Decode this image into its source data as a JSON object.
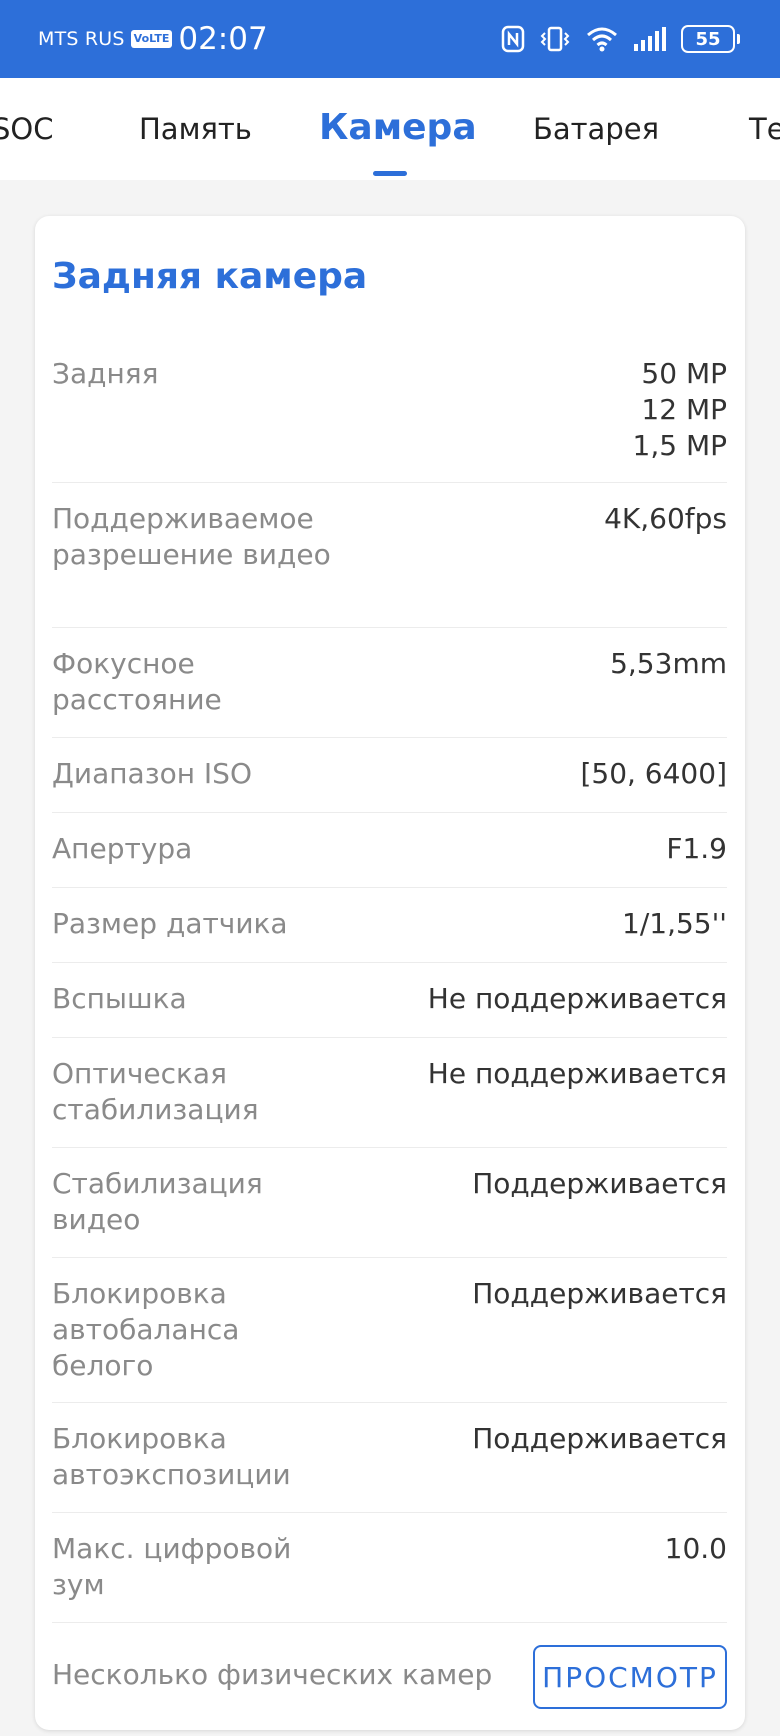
{
  "status_bar": {
    "carrier": "MTS RUS",
    "volte": "VoLTE",
    "time": "02:07",
    "battery_level": "55",
    "icons": [
      "nfc-icon",
      "vibrate-icon",
      "wifi-icon",
      "signal-icon",
      "battery-icon"
    ],
    "color": "#2d6fd9"
  },
  "tabs": [
    {
      "label": "SOC",
      "active": false
    },
    {
      "label": "Память",
      "active": false
    },
    {
      "label": "Камера",
      "active": true
    },
    {
      "label": "Батарея",
      "active": false
    },
    {
      "label": "Те",
      "active": false
    }
  ],
  "card": {
    "title": "Задняя камера",
    "rows": [
      {
        "label": "Задняя",
        "value": [
          "50 MP",
          "12 MP",
          "1,5 MP"
        ]
      },
      {
        "label": "Поддерживаемое разрешение видео",
        "value": [
          "4K,60fps"
        ]
      },
      {
        "label": "Фокусное расстояние",
        "value": [
          "5,53mm"
        ]
      },
      {
        "label": "Диапазон ISO",
        "value": [
          "[50, 6400]"
        ]
      },
      {
        "label": "Апертура",
        "value": [
          "F1.9"
        ]
      },
      {
        "label": "Размер датчика",
        "value": [
          "1/1,55''"
        ]
      },
      {
        "label": "Вспышка",
        "value": [
          "Не поддерживается"
        ]
      },
      {
        "label": "Оптическая стабилизация",
        "value": [
          "Не поддерживается"
        ]
      },
      {
        "label": "Стабилизация видео",
        "value": [
          "Поддерживается"
        ]
      },
      {
        "label": "Блокировка автобаланса белого",
        "value": [
          "Поддерживается"
        ]
      },
      {
        "label": "Блокировка автоэкспозиции",
        "value": [
          "Поддерживается"
        ]
      },
      {
        "label": "Макс. цифровой зум",
        "value": [
          "10.0"
        ]
      },
      {
        "label": "Несколько физических камер",
        "button": "ПРОСМОТР"
      }
    ]
  },
  "colors": {
    "accent": "#2d6fd9",
    "label": "#8a8a8a",
    "value": "#333333"
  }
}
